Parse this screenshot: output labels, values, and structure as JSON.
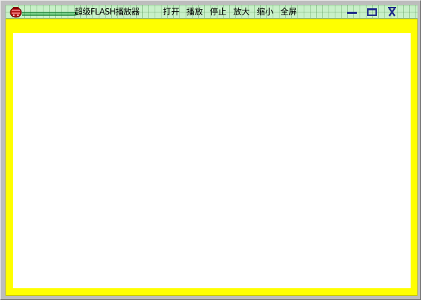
{
  "window": {
    "title": "超级FLASH播放器"
  },
  "menu": {
    "items": [
      {
        "id": "open",
        "label": "打开"
      },
      {
        "id": "play",
        "label": "播放"
      },
      {
        "id": "stop",
        "label": "停止"
      },
      {
        "id": "zoom-in",
        "label": "放大"
      },
      {
        "id": "zoom-out",
        "label": "缩小"
      },
      {
        "id": "fullscreen",
        "label": "全屏"
      }
    ]
  },
  "controls": {
    "minimize_icon": "minimize-icon",
    "maximize_icon": "maximize-icon",
    "close_icon": "close-icon"
  },
  "colors": {
    "titlebar_bg": "#c8f0c8",
    "frame": "#ffff00",
    "player_bg": "#ffffff",
    "control_glyph": "#1e2a8a",
    "icon_red": "#b01818"
  }
}
